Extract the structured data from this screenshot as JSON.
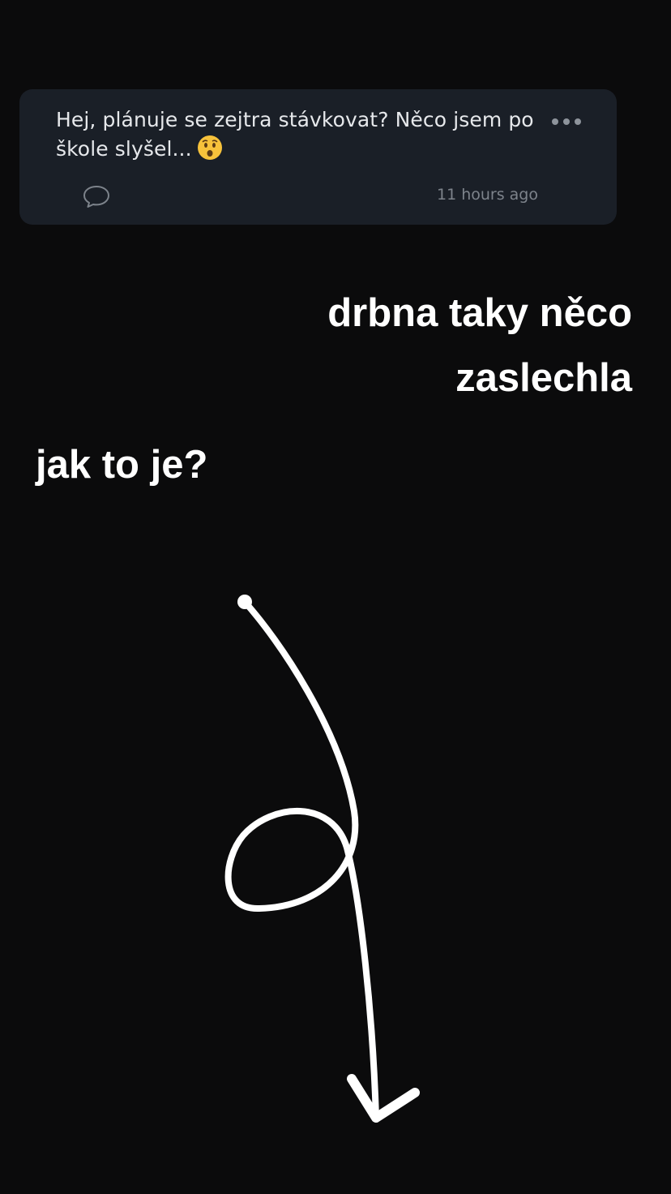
{
  "post": {
    "text": "Hej, plánuje se zejtra stávkovat? Něco jsem po škole slyšel...",
    "emoji": "hushed-face-emoji",
    "timestamp": "11 hours ago",
    "icons": {
      "comment": "comment-bubble-icon",
      "more": "more-dots-icon"
    }
  },
  "captions": {
    "right": "drbna taky něco zaslechla",
    "left": "jak to je?"
  },
  "drawing": {
    "type": "hand-drawn-arrow-pointing-down",
    "color": "#ffffff"
  },
  "colors": {
    "background": "#0b0b0c",
    "card": "#1a1f27",
    "card_text": "#e6e8eb",
    "muted": "#7d838b"
  }
}
